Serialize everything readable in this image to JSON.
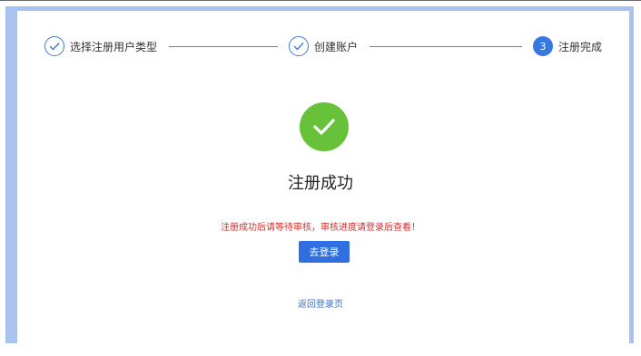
{
  "steps": [
    {
      "label": "选择注册用户类型",
      "state": "done",
      "icon": "check-icon"
    },
    {
      "label": "创建账户",
      "state": "done",
      "icon": "check-icon"
    },
    {
      "label": "注册完成",
      "state": "active",
      "number": "3"
    }
  ],
  "success": {
    "icon": "check-circle-icon",
    "title": "注册成功",
    "notice": "注册成功后请等待审核，审核进度请登录后查看！"
  },
  "actions": {
    "login_label": "去登录",
    "back_label": "返回登录页"
  },
  "colors": {
    "accent": "#2f6fe0",
    "success": "#67c23a",
    "warning_text": "#d0302c",
    "frame": "#a9c2ef"
  }
}
